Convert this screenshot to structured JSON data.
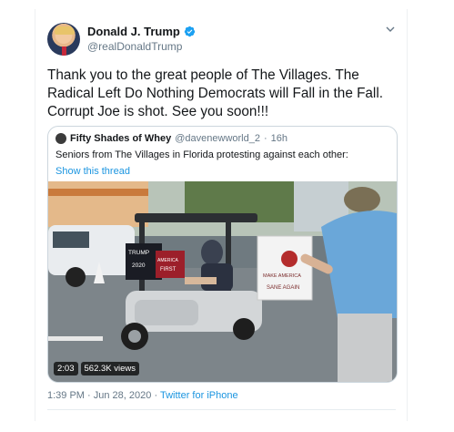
{
  "tweet": {
    "display_name": "Donald J. Trump",
    "handle": "@realDonaldTrump",
    "text": "Thank you to the great people of The Villages. The Radical Left Do Nothing Democrats will Fall in the Fall. Corrupt Joe is shot. See you soon!!!",
    "verified_icon": "verified-badge-icon",
    "menu_icon": "chevron-down-icon"
  },
  "quote": {
    "display_name": "Fifty Shades of Whey",
    "handle": "@davenewworld_2",
    "separator": "·",
    "time": "16h",
    "text": "Seniors from The Villages in Florida protesting against each other:",
    "show_thread": "Show this thread",
    "video": {
      "duration": "2:03",
      "views": "562.3K views",
      "sign_left_1": "TRUMP",
      "sign_left_2": "2020",
      "sign_left_3": "AMERICA",
      "sign_left_4": "FIRST",
      "sign_right_1": "MAKE AMERICA",
      "sign_right_2": "SANE AGAIN"
    }
  },
  "footer": {
    "time": "1:39 PM",
    "separator": "·",
    "date": "Jun 28, 2020",
    "separator2": "·",
    "source": "Twitter for iPhone"
  },
  "colors": {
    "link": "#1b95e0",
    "verified": "#1da1f2",
    "muted": "#657786",
    "border": "#ccd6dd"
  }
}
